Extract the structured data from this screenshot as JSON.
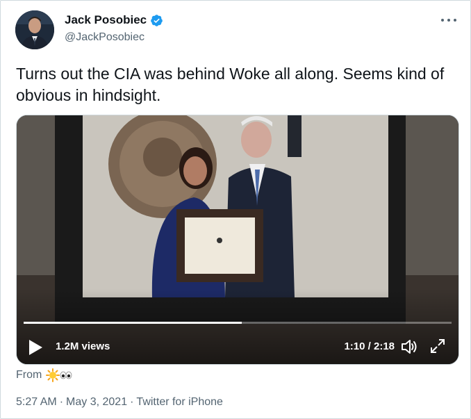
{
  "author": {
    "display_name": "Jack Posobiec",
    "handle": "@JackPosobiec",
    "verified": true
  },
  "tweet": {
    "text": "Turns out the CIA was behind Woke all along. Seems kind of obvious in hindsight."
  },
  "video": {
    "views": "1.2M views",
    "time": "1:10 / 2:18",
    "progress": 0.51
  },
  "from": {
    "label": "From",
    "emoji": "☀️👀"
  },
  "meta": {
    "time": "5:27 AM",
    "date": "May 3, 2021",
    "source": "Twitter for iPhone",
    "separator": "·"
  },
  "colors": {
    "verified": "#1d9bf0",
    "secondary_text": "#536471"
  }
}
